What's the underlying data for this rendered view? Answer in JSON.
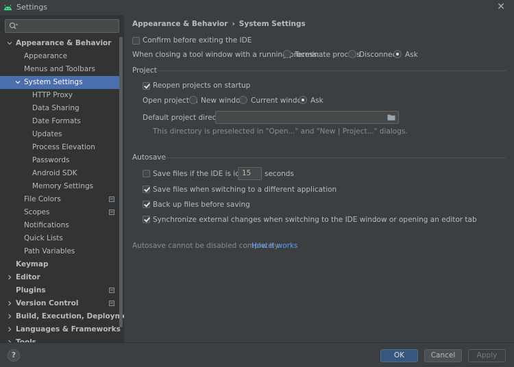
{
  "window": {
    "title": "Settings",
    "app_icon": "android-icon",
    "close_icon": "close-icon"
  },
  "sidebar": {
    "search": {
      "value": "",
      "placeholder": "",
      "icon": "search-icon"
    },
    "items": [
      {
        "label": "Appearance & Behavior",
        "level": 0,
        "expanded": true,
        "bold": true,
        "arrow": "down"
      },
      {
        "label": "Appearance",
        "level": 1
      },
      {
        "label": "Menus and Toolbars",
        "level": 1
      },
      {
        "label": "System Settings",
        "level": 1,
        "expanded": true,
        "arrow": "down",
        "selected": true
      },
      {
        "label": "HTTP Proxy",
        "level": 2
      },
      {
        "label": "Data Sharing",
        "level": 2
      },
      {
        "label": "Date Formats",
        "level": 2
      },
      {
        "label": "Updates",
        "level": 2
      },
      {
        "label": "Process Elevation",
        "level": 2
      },
      {
        "label": "Passwords",
        "level": 2
      },
      {
        "label": "Android SDK",
        "level": 2
      },
      {
        "label": "Memory Settings",
        "level": 2
      },
      {
        "label": "File Colors",
        "level": 1,
        "badge": true
      },
      {
        "label": "Scopes",
        "level": 1,
        "badge": true
      },
      {
        "label": "Notifications",
        "level": 1
      },
      {
        "label": "Quick Lists",
        "level": 1
      },
      {
        "label": "Path Variables",
        "level": 1
      },
      {
        "label": "Keymap",
        "level": 0,
        "bold": true
      },
      {
        "label": "Editor",
        "level": 0,
        "bold": true,
        "arrow": "right"
      },
      {
        "label": "Plugins",
        "level": 0,
        "bold": true,
        "badge": true
      },
      {
        "label": "Version Control",
        "level": 0,
        "bold": true,
        "arrow": "right",
        "badge": true
      },
      {
        "label": "Build, Execution, Deployment",
        "level": 0,
        "bold": true,
        "arrow": "right"
      },
      {
        "label": "Languages & Frameworks",
        "level": 0,
        "bold": true,
        "arrow": "right"
      },
      {
        "label": "Tools",
        "level": 0,
        "bold": true,
        "arrow": "right"
      }
    ]
  },
  "breadcrumb": {
    "parent": "Appearance & Behavior",
    "separator": "›",
    "current": "System Settings"
  },
  "general": {
    "confirm_exit": {
      "label": "Confirm before exiting the IDE",
      "checked": false
    },
    "tool_window_label": "When closing a tool window with a running process:",
    "tool_window_options": [
      {
        "label": "Terminate process",
        "checked": false
      },
      {
        "label": "Disconnect",
        "checked": false
      },
      {
        "label": "Ask",
        "checked": true
      }
    ]
  },
  "project": {
    "title": "Project",
    "reopen": {
      "label": "Reopen projects on startup",
      "checked": true
    },
    "open_in_label": "Open project in",
    "open_in_options": [
      {
        "label": "New window",
        "checked": false
      },
      {
        "label": "Current window",
        "checked": false
      },
      {
        "label": "Ask",
        "checked": true
      }
    ],
    "default_dir_label": "Default project directory:",
    "default_dir_value": "",
    "default_dir_hint": "This directory is preselected in \"Open...\" and \"New | Project...\" dialogs."
  },
  "autosave": {
    "title": "Autosave",
    "idle": {
      "label": "Save files if the IDE is idle for",
      "checked": false,
      "value": "15",
      "suffix": "seconds"
    },
    "switching": {
      "label": "Save files when switching to a different application",
      "checked": true
    },
    "backup": {
      "label": "Back up files before saving",
      "checked": true
    },
    "sync": {
      "label": "Synchronize external changes when switching to the IDE window or opening an editor tab",
      "checked": true
    },
    "note": "Autosave cannot be disabled completely.",
    "link": "How it works"
  },
  "buttons": {
    "help": "?",
    "ok": "OK",
    "cancel": "Cancel",
    "apply": "Apply"
  },
  "colors": {
    "selection": "#4b6eaf",
    "link": "#589df6",
    "primary_button": "#365880"
  }
}
